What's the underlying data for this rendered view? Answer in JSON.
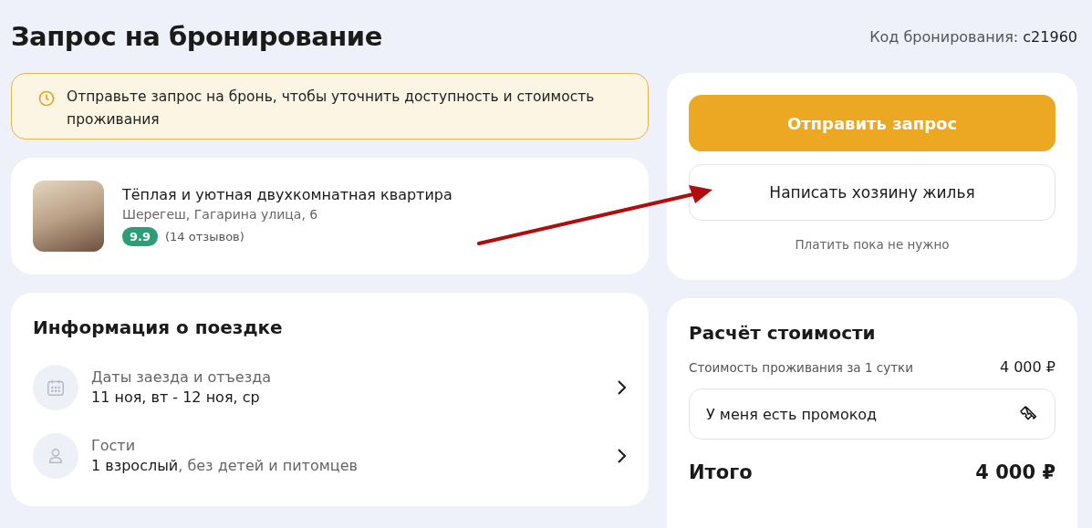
{
  "title": "Запрос на бронирование",
  "booking_code": {
    "label": "Код бронирования:",
    "value": "c21960"
  },
  "notice": {
    "text": "Отправьте запрос на бронь, чтобы уточнить доступность и стоимость проживания"
  },
  "property": {
    "name": "Тёплая и уютная двухкомнатная квартира",
    "address": "Шерегеш, Гагарина улица, 6",
    "rating": "9.9",
    "reviews": "(14 отзывов)"
  },
  "trip": {
    "title": "Информация о поездке",
    "items": [
      {
        "kind": "dates",
        "label": "Даты заезда и отъезда",
        "value": "11 ноя, вт - 12 ноя, ср"
      },
      {
        "kind": "guests",
        "label": "Гости",
        "value": "1 взрослый",
        "note": ", без детей и питомцев"
      }
    ]
  },
  "actions": {
    "primary": "Отправить запрос",
    "secondary": "Написать хозяину жилья",
    "hint": "Платить пока не нужно"
  },
  "price": {
    "title": "Расчёт стоимости",
    "rows": [
      {
        "label": "Стоимость проживания за 1 сутки",
        "value": "4 000 ₽"
      }
    ],
    "promo": "У меня есть промокод",
    "total_label": "Итого",
    "total_value": "4 000 ₽"
  },
  "annotation": {
    "kind": "arrow",
    "color": "#b00d0d"
  }
}
